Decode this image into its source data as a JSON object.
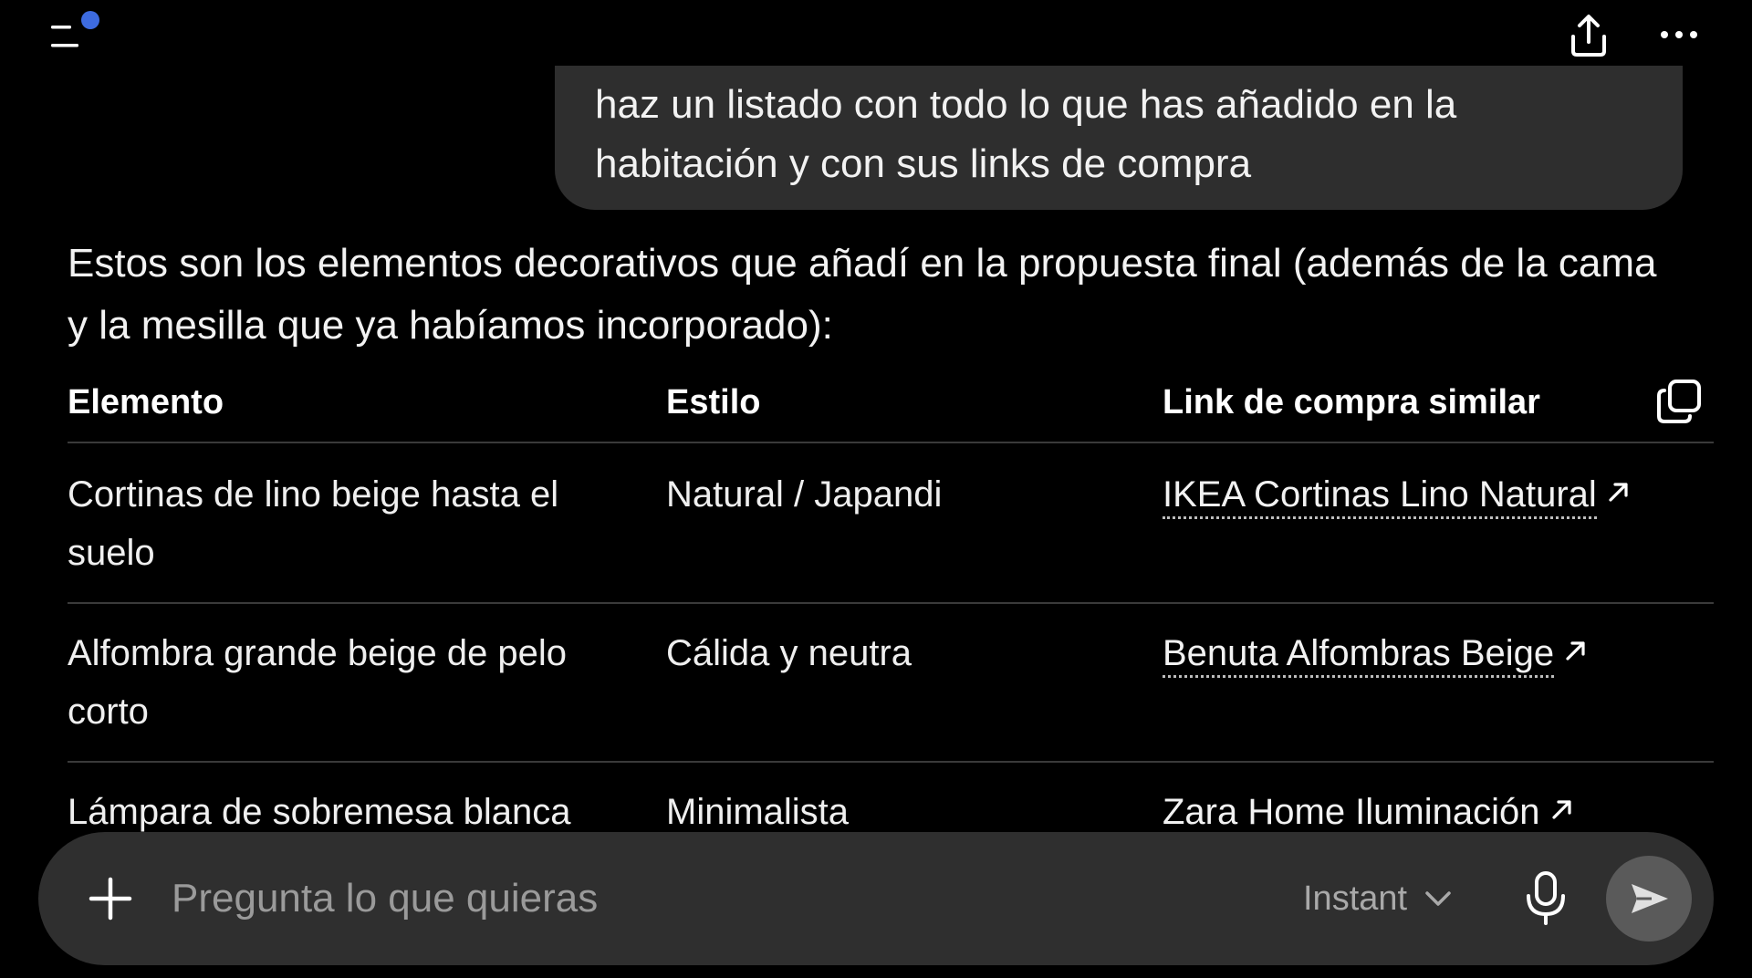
{
  "colors": {
    "background": "#000000",
    "bubble": "#2e2e2e",
    "composer": "#2f2f2f",
    "accent_dot": "#3d6be0",
    "send_button": "#5a5a5a"
  },
  "topbar": {
    "menu_icon": "sidebar-menu-icon",
    "share_icon": "share-icon",
    "more_icon": "more-icon"
  },
  "user_message": {
    "lines": [
      "haz un listado con todo lo que has añadido en la",
      "habitación y con sus links de compra"
    ]
  },
  "assistant": {
    "intro_lines": [
      "Estos son los elementos decorativos que añadí en la propuesta final (además de la cama",
      "y la mesilla que ya habíamos incorporado):"
    ],
    "table": {
      "headers": [
        "Elemento",
        "Estilo",
        "Link de compra similar"
      ],
      "rows": [
        {
          "element_lines": [
            "Cortinas de lino beige hasta el",
            "suelo"
          ],
          "style": "Natural / Japandi",
          "link": "IKEA Cortinas Lino Natural"
        },
        {
          "element_lines": [
            "Alfombra grande beige de pelo",
            "corto"
          ],
          "style": "Cálida y neutra",
          "link": "Benuta Alfombras Beige"
        },
        {
          "element_lines": [
            "Lámpara de sobremesa blanca"
          ],
          "style": "Minimalista",
          "link": "Zara Home Iluminación"
        }
      ]
    }
  },
  "composer": {
    "placeholder": "Pregunta lo que quieras",
    "mode": "Instant"
  }
}
